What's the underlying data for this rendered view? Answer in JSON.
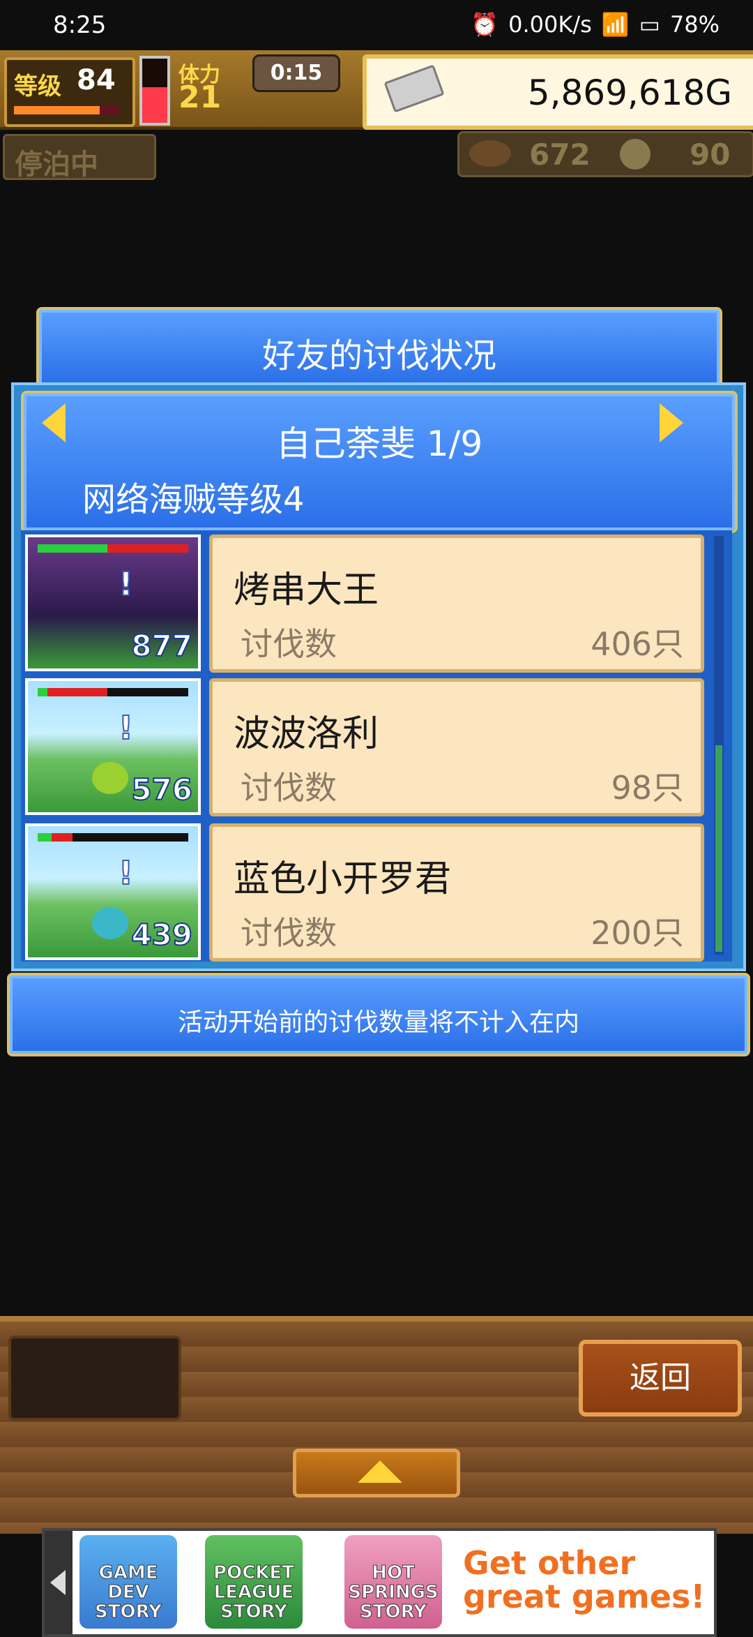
{
  "status_bar": {
    "time": "8:25",
    "network_speed": "0.00K/s",
    "battery": "78%"
  },
  "hud": {
    "level_label": "等级",
    "level_value": "84",
    "level_progress": 0.82,
    "stamina_label": "体力",
    "stamina_value": "21",
    "stamina_gauge_fill": 0.55,
    "timer": "0:15",
    "gold": "5,869,618G",
    "dock_status": "停泊中",
    "resource_1": "672",
    "resource_2": "90"
  },
  "dialog": {
    "title": "好友的讨伐状况",
    "friend_header": "自己荼斐 1/9",
    "subtitle": "网络海贼等级4",
    "entries": [
      {
        "name": "烤串大王",
        "kill_label": "讨伐数",
        "kill_value": "406只",
        "monster_level": "877",
        "hp_fill": 0.45
      },
      {
        "name": "波波洛利",
        "kill_label": "讨伐数",
        "kill_value": "98只",
        "monster_level": "576",
        "hp_fill": 0.45
      },
      {
        "name": "蓝色小开罗君",
        "kill_label": "讨伐数",
        "kill_value": "200只",
        "monster_level": "439",
        "hp_fill": 0.15
      }
    ],
    "notice": "活动开始前的讨伐数量将不计入在内"
  },
  "bottom": {
    "back_label": "返回"
  },
  "ad": {
    "games": [
      "GAME DEV STORY",
      "POCKET LEAGUE STORY",
      "HOT SPRINGS STORY"
    ],
    "cta_line1": "Get other",
    "cta_line2": "great games!"
  },
  "colors": {
    "panel_blue": "#2a6ee8",
    "card_bg": "#fbe6bf",
    "gold_text": "#ffd84a"
  }
}
